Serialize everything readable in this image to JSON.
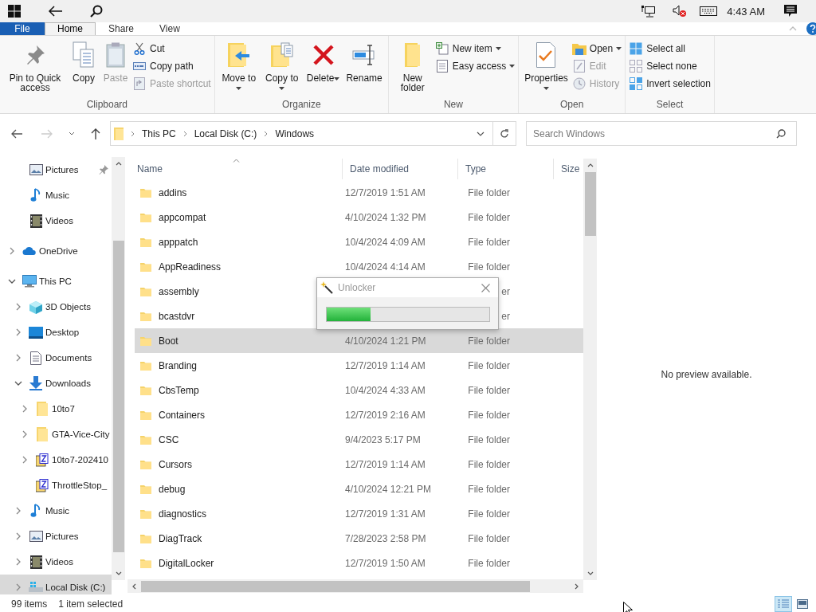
{
  "taskbar": {
    "time": "4:43 AM"
  },
  "ribbon_tabs": [
    {
      "label": "File",
      "kind": "file",
      "selected": false
    },
    {
      "label": "Home",
      "kind": "tab",
      "selected": true
    },
    {
      "label": "Share",
      "kind": "tab",
      "selected": false
    },
    {
      "label": "View",
      "kind": "tab",
      "selected": false
    }
  ],
  "ribbon_groups": [
    {
      "label": "Clipboard",
      "buttons": [
        {
          "kind": "large",
          "label": "Pin to Quick access",
          "disabled": false
        },
        {
          "kind": "large",
          "label": "Copy",
          "disabled": false
        },
        {
          "kind": "large",
          "label": "Paste",
          "disabled": true
        },
        {
          "kind": "small",
          "label": "Cut",
          "disabled": false
        },
        {
          "kind": "small",
          "label": "Copy path",
          "disabled": false
        },
        {
          "kind": "small",
          "label": "Paste shortcut",
          "disabled": true
        }
      ]
    },
    {
      "label": "Organize",
      "buttons": [
        {
          "kind": "large",
          "label": "Move to",
          "dropdown": true,
          "disabled": false
        },
        {
          "kind": "large",
          "label": "Copy to",
          "dropdown": true,
          "disabled": false
        },
        {
          "kind": "large",
          "label": "Delete",
          "dropdown": true,
          "disabled": false
        },
        {
          "kind": "large",
          "label": "Rename",
          "disabled": false
        }
      ]
    },
    {
      "label": "New",
      "buttons": [
        {
          "kind": "large",
          "label": "New folder",
          "disabled": false
        },
        {
          "kind": "small",
          "label": "New item",
          "dropdown": true,
          "disabled": false
        },
        {
          "kind": "small",
          "label": "Easy access",
          "dropdown": true,
          "disabled": false
        }
      ]
    },
    {
      "label": "Open",
      "buttons": [
        {
          "kind": "large",
          "label": "Properties",
          "dropdown": true,
          "disabled": false
        },
        {
          "kind": "small",
          "label": "Open",
          "dropdown": true,
          "disabled": false
        },
        {
          "kind": "small",
          "label": "Edit",
          "disabled": true
        },
        {
          "kind": "small",
          "label": "History",
          "disabled": true
        }
      ]
    },
    {
      "label": "Select",
      "buttons": [
        {
          "kind": "small",
          "label": "Select all",
          "disabled": false
        },
        {
          "kind": "small",
          "label": "Select none",
          "disabled": false
        },
        {
          "kind": "small",
          "label": "Invert selection",
          "disabled": false
        }
      ]
    }
  ],
  "address": {
    "breadcrumbs": [
      "This PC",
      "Local Disk (C:)",
      "Windows"
    ]
  },
  "search": {
    "placeholder": "Search Windows"
  },
  "navigation": {
    "pinned": [
      {
        "label": "Pictures",
        "kind": "pictures",
        "pinned": true,
        "selected": false
      },
      {
        "label": "Music",
        "kind": "music",
        "pinned": false,
        "selected": false
      },
      {
        "label": "Videos",
        "kind": "videos",
        "pinned": false,
        "selected": false
      }
    ],
    "items": [
      {
        "label": "OneDrive",
        "kind": "cloud",
        "expanded": false,
        "selected": false
      },
      {
        "label": "This PC",
        "kind": "pc",
        "expanded": true,
        "selected": false,
        "children": [
          {
            "label": "3D Objects",
            "kind": "cube",
            "expanded": false,
            "selected": false
          },
          {
            "label": "Desktop",
            "kind": "desktop",
            "expanded": false,
            "selected": false
          },
          {
            "label": "Documents",
            "kind": "documents",
            "expanded": false,
            "selected": false
          },
          {
            "label": "Downloads",
            "kind": "downloads",
            "expanded": true,
            "selected": false,
            "children": [
              {
                "label": "10to7",
                "kind": "folder",
                "expanded": false,
                "selected": false
              },
              {
                "label": "GTA-Vice-City",
                "kind": "folder",
                "expanded": false,
                "selected": false
              },
              {
                "label": "10to7-202410",
                "kind": "archive",
                "expanded": false,
                "selected": false
              },
              {
                "label": "ThrottleStop_",
                "kind": "archive",
                "selected": false
              }
            ]
          },
          {
            "label": "Music",
            "kind": "music",
            "expanded": false,
            "selected": false
          },
          {
            "label": "Pictures",
            "kind": "pictures",
            "expanded": false,
            "selected": false
          },
          {
            "label": "Videos",
            "kind": "videos",
            "expanded": false,
            "selected": false
          },
          {
            "label": "Local Disk (C:)",
            "kind": "disk",
            "expanded": false,
            "selected": true
          }
        ]
      }
    ]
  },
  "file_list": {
    "columns": [
      "Name",
      "Date modified",
      "Type",
      "Size"
    ],
    "rows": [
      {
        "name": "addins",
        "date": "12/7/2019 1:51 AM",
        "type": "File folder",
        "selected": false
      },
      {
        "name": "appcompat",
        "date": "4/10/2024 1:32 PM",
        "type": "File folder",
        "selected": false
      },
      {
        "name": "apppatch",
        "date": "10/4/2024 4:09 AM",
        "type": "File folder",
        "selected": false
      },
      {
        "name": "AppReadiness",
        "date": "10/4/2024 4:14 AM",
        "type": "File folder",
        "selected": false
      },
      {
        "name": "assembly",
        "type": "er",
        "selected": false
      },
      {
        "name": "bcastdvr",
        "type": "er",
        "selected": false
      },
      {
        "name": "Boot",
        "date": "4/10/2024 1:21 PM",
        "type": "File folder",
        "selected": true
      },
      {
        "name": "Branding",
        "date": "12/7/2019 1:14 AM",
        "type": "File folder",
        "selected": false
      },
      {
        "name": "CbsTemp",
        "date": "10/4/2024 4:33 AM",
        "type": "File folder",
        "selected": false
      },
      {
        "name": "Containers",
        "date": "12/7/2019 2:16 AM",
        "type": "File folder",
        "selected": false
      },
      {
        "name": "CSC",
        "date": "9/4/2023 5:17 PM",
        "type": "File folder",
        "selected": false
      },
      {
        "name": "Cursors",
        "date": "12/7/2019 1:14 AM",
        "type": "File folder",
        "selected": false
      },
      {
        "name": "debug",
        "date": "4/10/2024 12:21 PM",
        "type": "File folder",
        "selected": false
      },
      {
        "name": "diagnostics",
        "date": "12/7/2019 1:31 AM",
        "type": "File folder",
        "selected": false
      },
      {
        "name": "DiagTrack",
        "date": "7/28/2023 2:58 PM",
        "type": "File folder",
        "selected": false
      },
      {
        "name": "DigitalLocker",
        "date": "12/7/2019 1:50 AM",
        "type": "File folder",
        "selected": false
      }
    ]
  },
  "preview": {
    "message": "No preview available."
  },
  "status_bar": {
    "item_count": "99 items",
    "selection": "1 item selected",
    "views": [
      {
        "selected": true
      },
      {
        "selected": false
      }
    ]
  },
  "dialog": {
    "title": "Unlocker",
    "level": 0.27
  }
}
